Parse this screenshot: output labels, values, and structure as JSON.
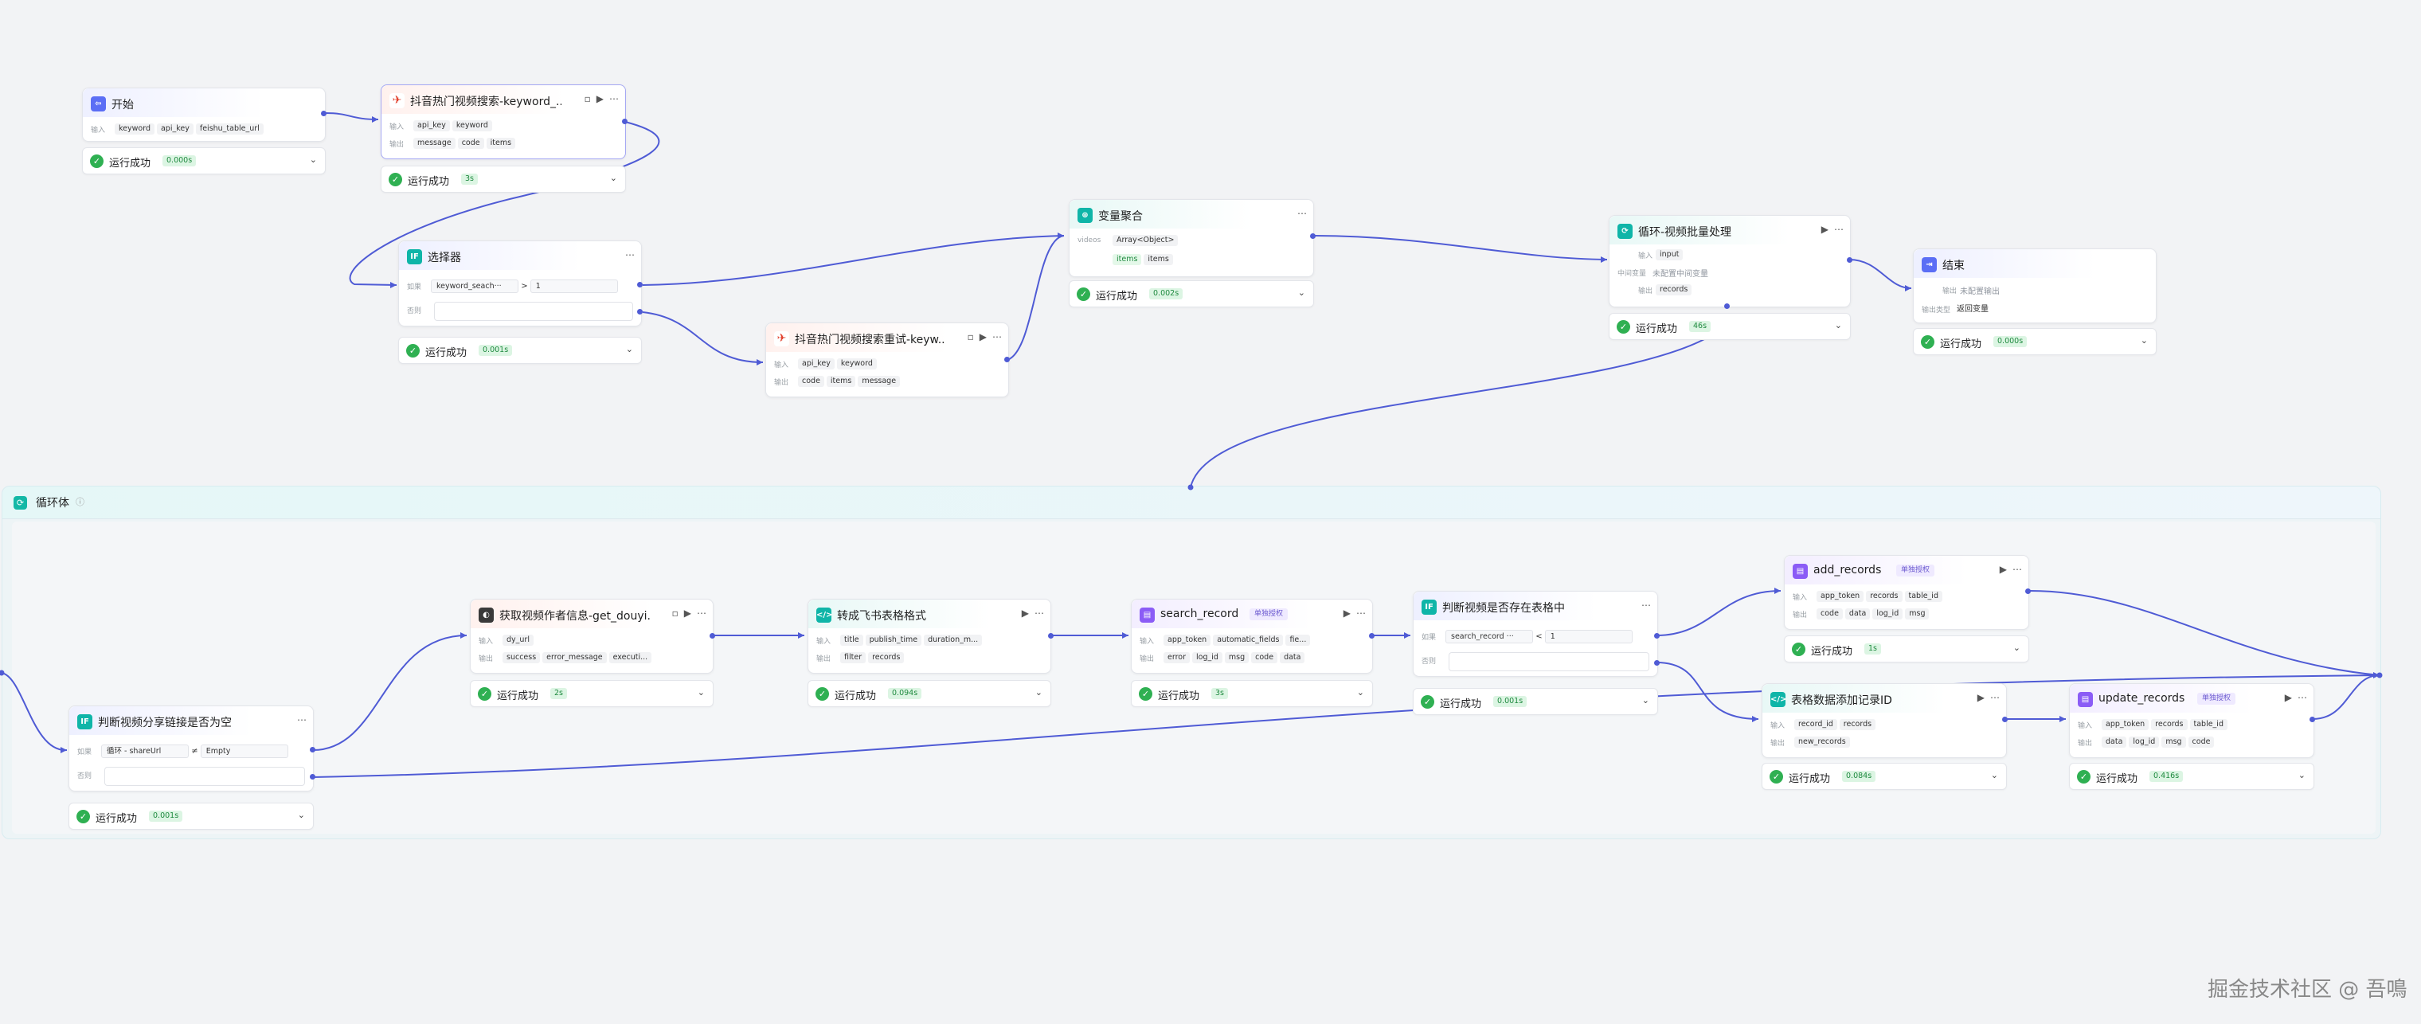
{
  "loop": {
    "title": "循环体",
    "info": "ⓘ"
  },
  "status_label": "运行成功",
  "nodes": {
    "start": {
      "title": "开始",
      "icon": "start-icon",
      "in_label": "输入",
      "inputs": [
        "keyword",
        "api_key",
        "feishu_table_url"
      ],
      "time": "0.000s"
    },
    "search1": {
      "title": "抖音热门视频搜索-keyword_...",
      "icon": "douyin-icon",
      "in_label": "输入",
      "out_label": "输出",
      "inputs": [
        "api_key",
        "keyword"
      ],
      "outputs": [
        "message",
        "code",
        "items"
      ],
      "time": "3s"
    },
    "selector": {
      "title": "选择器",
      "icon": "if-icon",
      "if_label": "如果",
      "else_label": "否则",
      "var": "keyword_seach···",
      "op": ">",
      "val": "1",
      "time": "0.001s"
    },
    "search2": {
      "title": "抖音热门视频搜索重试-keyw...",
      "icon": "douyin-icon",
      "in_label": "输入",
      "out_label": "输出",
      "inputs": [
        "api_key",
        "keyword"
      ],
      "outputs": [
        "code",
        "items",
        "message"
      ]
    },
    "aggregate": {
      "title": "变量聚合",
      "icon": "aggregate-icon",
      "var_label": "videos",
      "type_chip": "Array<Object>",
      "items": [
        "items",
        "items"
      ],
      "time": "0.002s"
    },
    "loop_batch": {
      "title": "循环-视频批量处理",
      "icon": "loop-icon",
      "in_label": "输入",
      "mid_label": "中间变量",
      "mid_text": "未配置中间变量",
      "out_label": "输出",
      "inputs": [
        "input"
      ],
      "outputs": [
        "records"
      ],
      "time": "46s"
    },
    "end": {
      "title": "结束",
      "icon": "end-icon",
      "out_label": "输出",
      "out_text": "未配置输出",
      "mode_label": "输出类型",
      "mode_text": "返回变量",
      "time": "0.000s"
    },
    "check_url": {
      "title": "判断视频分享链接是否为空",
      "icon": "if-icon",
      "if_label": "如果",
      "else_label": "否则",
      "var1": "循环",
      "var2": "shareUrl",
      "op": "≠",
      "val": "Empty",
      "time": "0.001s"
    },
    "get_author": {
      "title": "获取视频作者信息-get_douyi...",
      "icon": "author-icon",
      "in_label": "输入",
      "out_label": "输出",
      "inputs": [
        "dy_url"
      ],
      "outputs": [
        "success",
        "error_message",
        "executi..."
      ],
      "time": "2s"
    },
    "to_table": {
      "title": "转成飞书表格格式",
      "icon": "code-icon",
      "in_label": "输入",
      "out_label": "输出",
      "inputs": [
        "title",
        "publish_time",
        "duration_m..."
      ],
      "outputs": [
        "filter",
        "records"
      ],
      "time": "0.094s"
    },
    "search_record": {
      "title": "search_record",
      "badge": "单独授权",
      "icon": "plugin-icon",
      "in_label": "输入",
      "out_label": "输出",
      "inputs": [
        "app_token",
        "automatic_fields",
        "fie..."
      ],
      "outputs": [
        "error",
        "log_id",
        "msg",
        "code",
        "data"
      ],
      "time": "3s"
    },
    "exists": {
      "title": "判断视频是否存在表格中",
      "icon": "if-icon",
      "if_label": "如果",
      "else_label": "否则",
      "var": "search_record ···",
      "op": "<",
      "val": "1",
      "time": "0.001s"
    },
    "add_records": {
      "title": "add_records",
      "badge": "单独授权",
      "icon": "plugin-icon",
      "in_label": "输入",
      "out_label": "输出",
      "inputs": [
        "app_token",
        "records",
        "table_id"
      ],
      "outputs": [
        "code",
        "data",
        "log_id",
        "msg"
      ],
      "time": "1s"
    },
    "add_id": {
      "title": "表格数据添加记录ID",
      "icon": "code-icon",
      "in_label": "输入",
      "out_label": "输出",
      "inputs": [
        "record_id",
        "records"
      ],
      "outputs": [
        "new_records"
      ],
      "time": "0.084s"
    },
    "update_records": {
      "title": "update_records",
      "badge": "单独授权",
      "icon": "plugin-icon",
      "in_label": "输入",
      "out_label": "输出",
      "inputs": [
        "app_token",
        "records",
        "table_id"
      ],
      "outputs": [
        "data",
        "log_id",
        "msg",
        "code"
      ],
      "time": "0.416s"
    }
  },
  "watermark": "掘金技术社区 @ 吾鳴",
  "colors": {
    "edge": "#4f5bd5",
    "success": "#2fb052",
    "canvas": "#f2f3f5"
  }
}
